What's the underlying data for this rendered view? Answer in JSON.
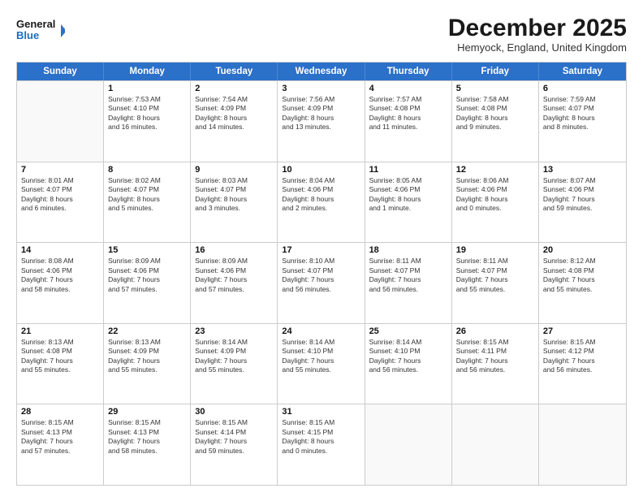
{
  "header": {
    "logo_line1": "General",
    "logo_line2": "Blue",
    "title": "December 2025",
    "subtitle": "Hemyock, England, United Kingdom"
  },
  "weekdays": [
    "Sunday",
    "Monday",
    "Tuesday",
    "Wednesday",
    "Thursday",
    "Friday",
    "Saturday"
  ],
  "weeks": [
    [
      {
        "day": "",
        "lines": []
      },
      {
        "day": "1",
        "lines": [
          "Sunrise: 7:53 AM",
          "Sunset: 4:10 PM",
          "Daylight: 8 hours",
          "and 16 minutes."
        ]
      },
      {
        "day": "2",
        "lines": [
          "Sunrise: 7:54 AM",
          "Sunset: 4:09 PM",
          "Daylight: 8 hours",
          "and 14 minutes."
        ]
      },
      {
        "day": "3",
        "lines": [
          "Sunrise: 7:56 AM",
          "Sunset: 4:09 PM",
          "Daylight: 8 hours",
          "and 13 minutes."
        ]
      },
      {
        "day": "4",
        "lines": [
          "Sunrise: 7:57 AM",
          "Sunset: 4:08 PM",
          "Daylight: 8 hours",
          "and 11 minutes."
        ]
      },
      {
        "day": "5",
        "lines": [
          "Sunrise: 7:58 AM",
          "Sunset: 4:08 PM",
          "Daylight: 8 hours",
          "and 9 minutes."
        ]
      },
      {
        "day": "6",
        "lines": [
          "Sunrise: 7:59 AM",
          "Sunset: 4:07 PM",
          "Daylight: 8 hours",
          "and 8 minutes."
        ]
      }
    ],
    [
      {
        "day": "7",
        "lines": [
          "Sunrise: 8:01 AM",
          "Sunset: 4:07 PM",
          "Daylight: 8 hours",
          "and 6 minutes."
        ]
      },
      {
        "day": "8",
        "lines": [
          "Sunrise: 8:02 AM",
          "Sunset: 4:07 PM",
          "Daylight: 8 hours",
          "and 5 minutes."
        ]
      },
      {
        "day": "9",
        "lines": [
          "Sunrise: 8:03 AM",
          "Sunset: 4:07 PM",
          "Daylight: 8 hours",
          "and 3 minutes."
        ]
      },
      {
        "day": "10",
        "lines": [
          "Sunrise: 8:04 AM",
          "Sunset: 4:06 PM",
          "Daylight: 8 hours",
          "and 2 minutes."
        ]
      },
      {
        "day": "11",
        "lines": [
          "Sunrise: 8:05 AM",
          "Sunset: 4:06 PM",
          "Daylight: 8 hours",
          "and 1 minute."
        ]
      },
      {
        "day": "12",
        "lines": [
          "Sunrise: 8:06 AM",
          "Sunset: 4:06 PM",
          "Daylight: 8 hours",
          "and 0 minutes."
        ]
      },
      {
        "day": "13",
        "lines": [
          "Sunrise: 8:07 AM",
          "Sunset: 4:06 PM",
          "Daylight: 7 hours",
          "and 59 minutes."
        ]
      }
    ],
    [
      {
        "day": "14",
        "lines": [
          "Sunrise: 8:08 AM",
          "Sunset: 4:06 PM",
          "Daylight: 7 hours",
          "and 58 minutes."
        ]
      },
      {
        "day": "15",
        "lines": [
          "Sunrise: 8:09 AM",
          "Sunset: 4:06 PM",
          "Daylight: 7 hours",
          "and 57 minutes."
        ]
      },
      {
        "day": "16",
        "lines": [
          "Sunrise: 8:09 AM",
          "Sunset: 4:06 PM",
          "Daylight: 7 hours",
          "and 57 minutes."
        ]
      },
      {
        "day": "17",
        "lines": [
          "Sunrise: 8:10 AM",
          "Sunset: 4:07 PM",
          "Daylight: 7 hours",
          "and 56 minutes."
        ]
      },
      {
        "day": "18",
        "lines": [
          "Sunrise: 8:11 AM",
          "Sunset: 4:07 PM",
          "Daylight: 7 hours",
          "and 56 minutes."
        ]
      },
      {
        "day": "19",
        "lines": [
          "Sunrise: 8:11 AM",
          "Sunset: 4:07 PM",
          "Daylight: 7 hours",
          "and 55 minutes."
        ]
      },
      {
        "day": "20",
        "lines": [
          "Sunrise: 8:12 AM",
          "Sunset: 4:08 PM",
          "Daylight: 7 hours",
          "and 55 minutes."
        ]
      }
    ],
    [
      {
        "day": "21",
        "lines": [
          "Sunrise: 8:13 AM",
          "Sunset: 4:08 PM",
          "Daylight: 7 hours",
          "and 55 minutes."
        ]
      },
      {
        "day": "22",
        "lines": [
          "Sunrise: 8:13 AM",
          "Sunset: 4:09 PM",
          "Daylight: 7 hours",
          "and 55 minutes."
        ]
      },
      {
        "day": "23",
        "lines": [
          "Sunrise: 8:14 AM",
          "Sunset: 4:09 PM",
          "Daylight: 7 hours",
          "and 55 minutes."
        ]
      },
      {
        "day": "24",
        "lines": [
          "Sunrise: 8:14 AM",
          "Sunset: 4:10 PM",
          "Daylight: 7 hours",
          "and 55 minutes."
        ]
      },
      {
        "day": "25",
        "lines": [
          "Sunrise: 8:14 AM",
          "Sunset: 4:10 PM",
          "Daylight: 7 hours",
          "and 56 minutes."
        ]
      },
      {
        "day": "26",
        "lines": [
          "Sunrise: 8:15 AM",
          "Sunset: 4:11 PM",
          "Daylight: 7 hours",
          "and 56 minutes."
        ]
      },
      {
        "day": "27",
        "lines": [
          "Sunrise: 8:15 AM",
          "Sunset: 4:12 PM",
          "Daylight: 7 hours",
          "and 56 minutes."
        ]
      }
    ],
    [
      {
        "day": "28",
        "lines": [
          "Sunrise: 8:15 AM",
          "Sunset: 4:13 PM",
          "Daylight: 7 hours",
          "and 57 minutes."
        ]
      },
      {
        "day": "29",
        "lines": [
          "Sunrise: 8:15 AM",
          "Sunset: 4:13 PM",
          "Daylight: 7 hours",
          "and 58 minutes."
        ]
      },
      {
        "day": "30",
        "lines": [
          "Sunrise: 8:15 AM",
          "Sunset: 4:14 PM",
          "Daylight: 7 hours",
          "and 59 minutes."
        ]
      },
      {
        "day": "31",
        "lines": [
          "Sunrise: 8:15 AM",
          "Sunset: 4:15 PM",
          "Daylight: 8 hours",
          "and 0 minutes."
        ]
      },
      {
        "day": "",
        "lines": []
      },
      {
        "day": "",
        "lines": []
      },
      {
        "day": "",
        "lines": []
      }
    ]
  ]
}
